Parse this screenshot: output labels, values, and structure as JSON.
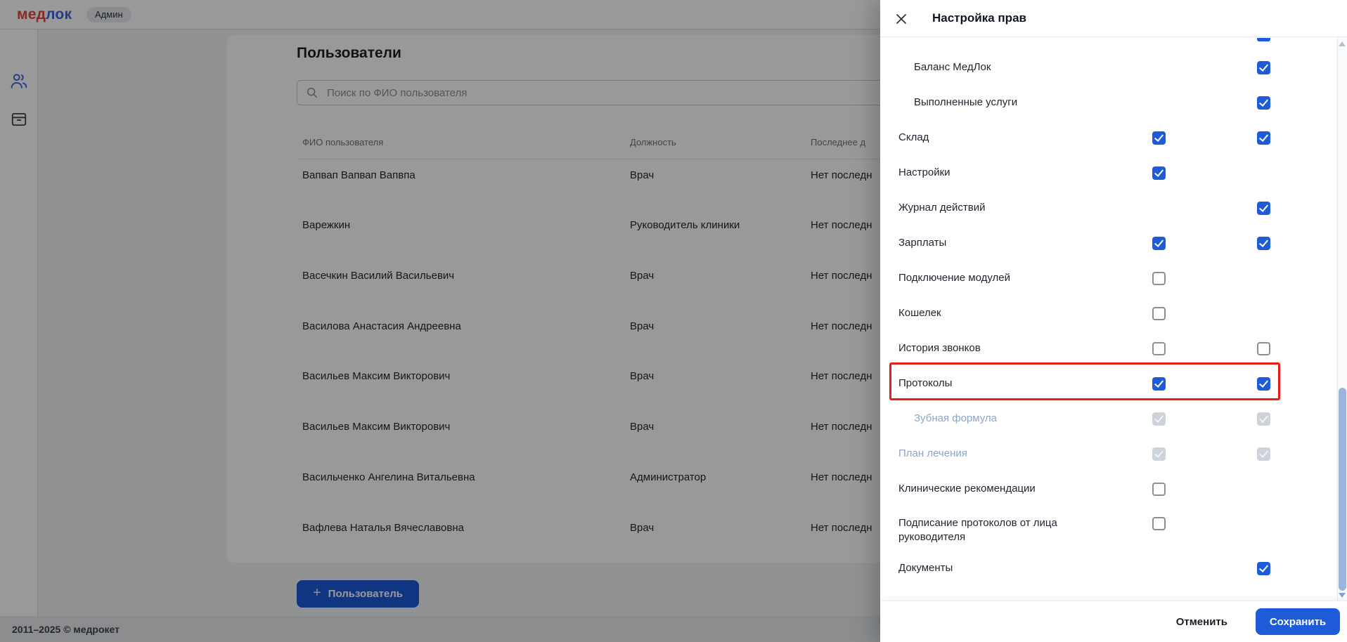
{
  "header": {
    "logo_part1": "мед",
    "logo_part2": "лок",
    "badge": "Админ"
  },
  "sidebar": {
    "items": [
      {
        "icon": "users-icon"
      },
      {
        "icon": "storage-box-icon"
      }
    ],
    "collapse_icon": "chevron-right-icon"
  },
  "page": {
    "title": "Пользователи",
    "search_placeholder": "Поиск по ФИО пользователя",
    "table": {
      "columns": [
        "ФИО пользователя",
        "Должность",
        "Последнее д"
      ],
      "rows": [
        [
          "Вапвап Вапвап Вапвпа",
          "Врач",
          "Нет последн"
        ],
        [
          "Варежкин",
          "Руководитель клиники",
          "Нет последн"
        ],
        [
          "Васечкин Василий Васильевич",
          "Врач",
          "Нет последн"
        ],
        [
          "Василова Анастасия Андреевна",
          "Врач",
          "Нет последн"
        ],
        [
          "Васильев Максим Викторович",
          "Врач",
          "Нет последн"
        ],
        [
          "Васильев Максим Викторович",
          "Врач",
          "Нет последн"
        ],
        [
          "Васильченко Ангелина Витальевна",
          "Администратор",
          "Нет последн"
        ],
        [
          "Вафлева Наталья Вячеславовна",
          "Врач",
          "Нет последн"
        ]
      ]
    },
    "add_user_label": "Пользователь",
    "copyright": "2011–2025 © медрокет"
  },
  "modal": {
    "title": "Настройка прав",
    "permissions": [
      {
        "label": "",
        "col1": null,
        "col2": "checked",
        "partial": true
      },
      {
        "label": "Баланс МедЛок",
        "indent": true,
        "col1": null,
        "col2": "checked"
      },
      {
        "label": "Выполненные услуги",
        "indent": true,
        "col1": null,
        "col2": "checked"
      },
      {
        "label": "Склад",
        "col1": "checked",
        "col2": "checked"
      },
      {
        "label": "Настройки",
        "col1": "checked",
        "col2": null
      },
      {
        "label": "Журнал действий",
        "col1": null,
        "col2": "checked"
      },
      {
        "label": "Зарплаты",
        "col1": "checked",
        "col2": "checked"
      },
      {
        "label": "Подключение модулей",
        "col1": "unchecked",
        "col2": null
      },
      {
        "label": "Кошелек",
        "col1": "unchecked",
        "col2": null
      },
      {
        "label": "История звонков",
        "col1": "unchecked",
        "col2": "unchecked"
      },
      {
        "label": "Протоколы",
        "col1": "checked",
        "col2": "checked",
        "highlighted": true
      },
      {
        "label": "Зубная формула",
        "indent": true,
        "disabled": true,
        "col1": "disabled-checked",
        "col2": "disabled-checked"
      },
      {
        "label": "План лечения",
        "disabled": true,
        "col1": "disabled-checked",
        "col2": "disabled-checked"
      },
      {
        "label": "Клинические рекомендации",
        "col1": "unchecked",
        "col2": null
      },
      {
        "label": "Подписание протоколов от лица руководителя",
        "col1": "unchecked",
        "col2": null,
        "multiline": true
      },
      {
        "label": "Документы",
        "col1": null,
        "col2": "checked"
      }
    ],
    "cancel_label": "Отменить",
    "save_label": "Сохранить"
  },
  "colors": {
    "accent": "#1d5bd8",
    "logo_red": "#e0473b",
    "logo_blue": "#3a66d9",
    "highlight_red": "#ea1c15",
    "disabled_label": "#8da4c9"
  }
}
